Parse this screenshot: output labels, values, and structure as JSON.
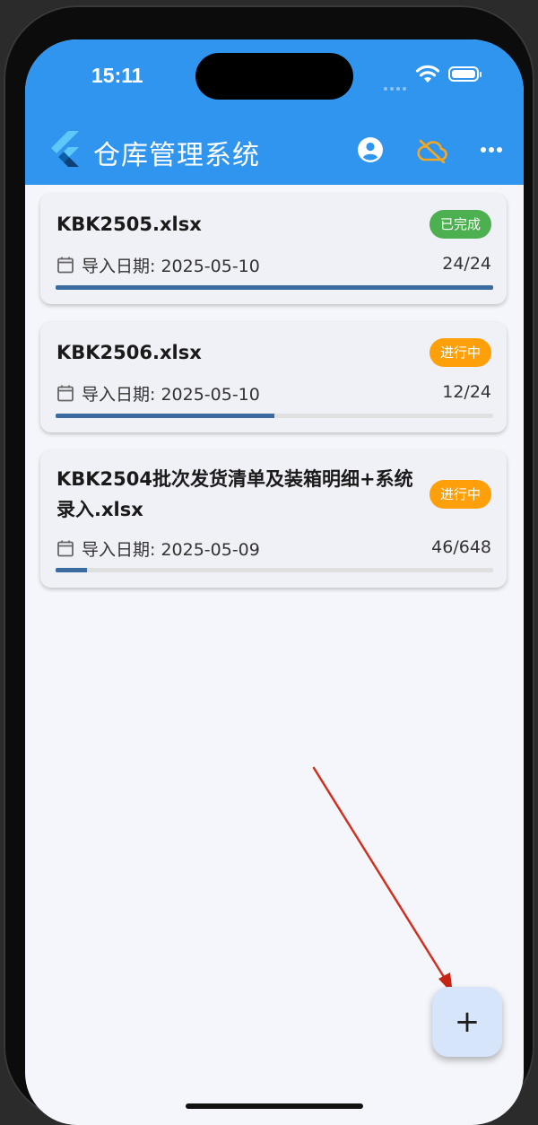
{
  "status_bar": {
    "time": "15:11"
  },
  "app_bar": {
    "title": "仓库管理系统",
    "icons": [
      "flutter-logo",
      "account-circle-icon",
      "cloud-off-icon",
      "more-horizontal-icon"
    ],
    "cloud_icon_color": "#f5a623"
  },
  "imports": [
    {
      "title_line1": "KBK2505.xlsx",
      "title_line2": "",
      "status": "已完成",
      "status_color": "#4caf50",
      "date_label": "导入日期: 2025-05-10",
      "count": "24/24",
      "progress": 1.0
    },
    {
      "title_line1": "KBK2506.xlsx",
      "title_line2": "",
      "status": "进行中",
      "status_color": "#ff9f0a",
      "date_label": "导入日期: 2025-05-10",
      "count": "12/24",
      "progress": 0.5
    },
    {
      "title_line1": "KBK2504批次发货清单及装箱明细+系统",
      "title_line2": "录入.xlsx",
      "status": "进行中",
      "status_color": "#ff9f0a",
      "date_label": "导入日期: 2025-05-09",
      "count": "46/648",
      "progress": 0.071
    }
  ],
  "fab": {
    "label": "+"
  },
  "colors": {
    "app_bar": "#2f95ee",
    "progress": "#3a6a9f",
    "background": "#f5f6fb"
  }
}
